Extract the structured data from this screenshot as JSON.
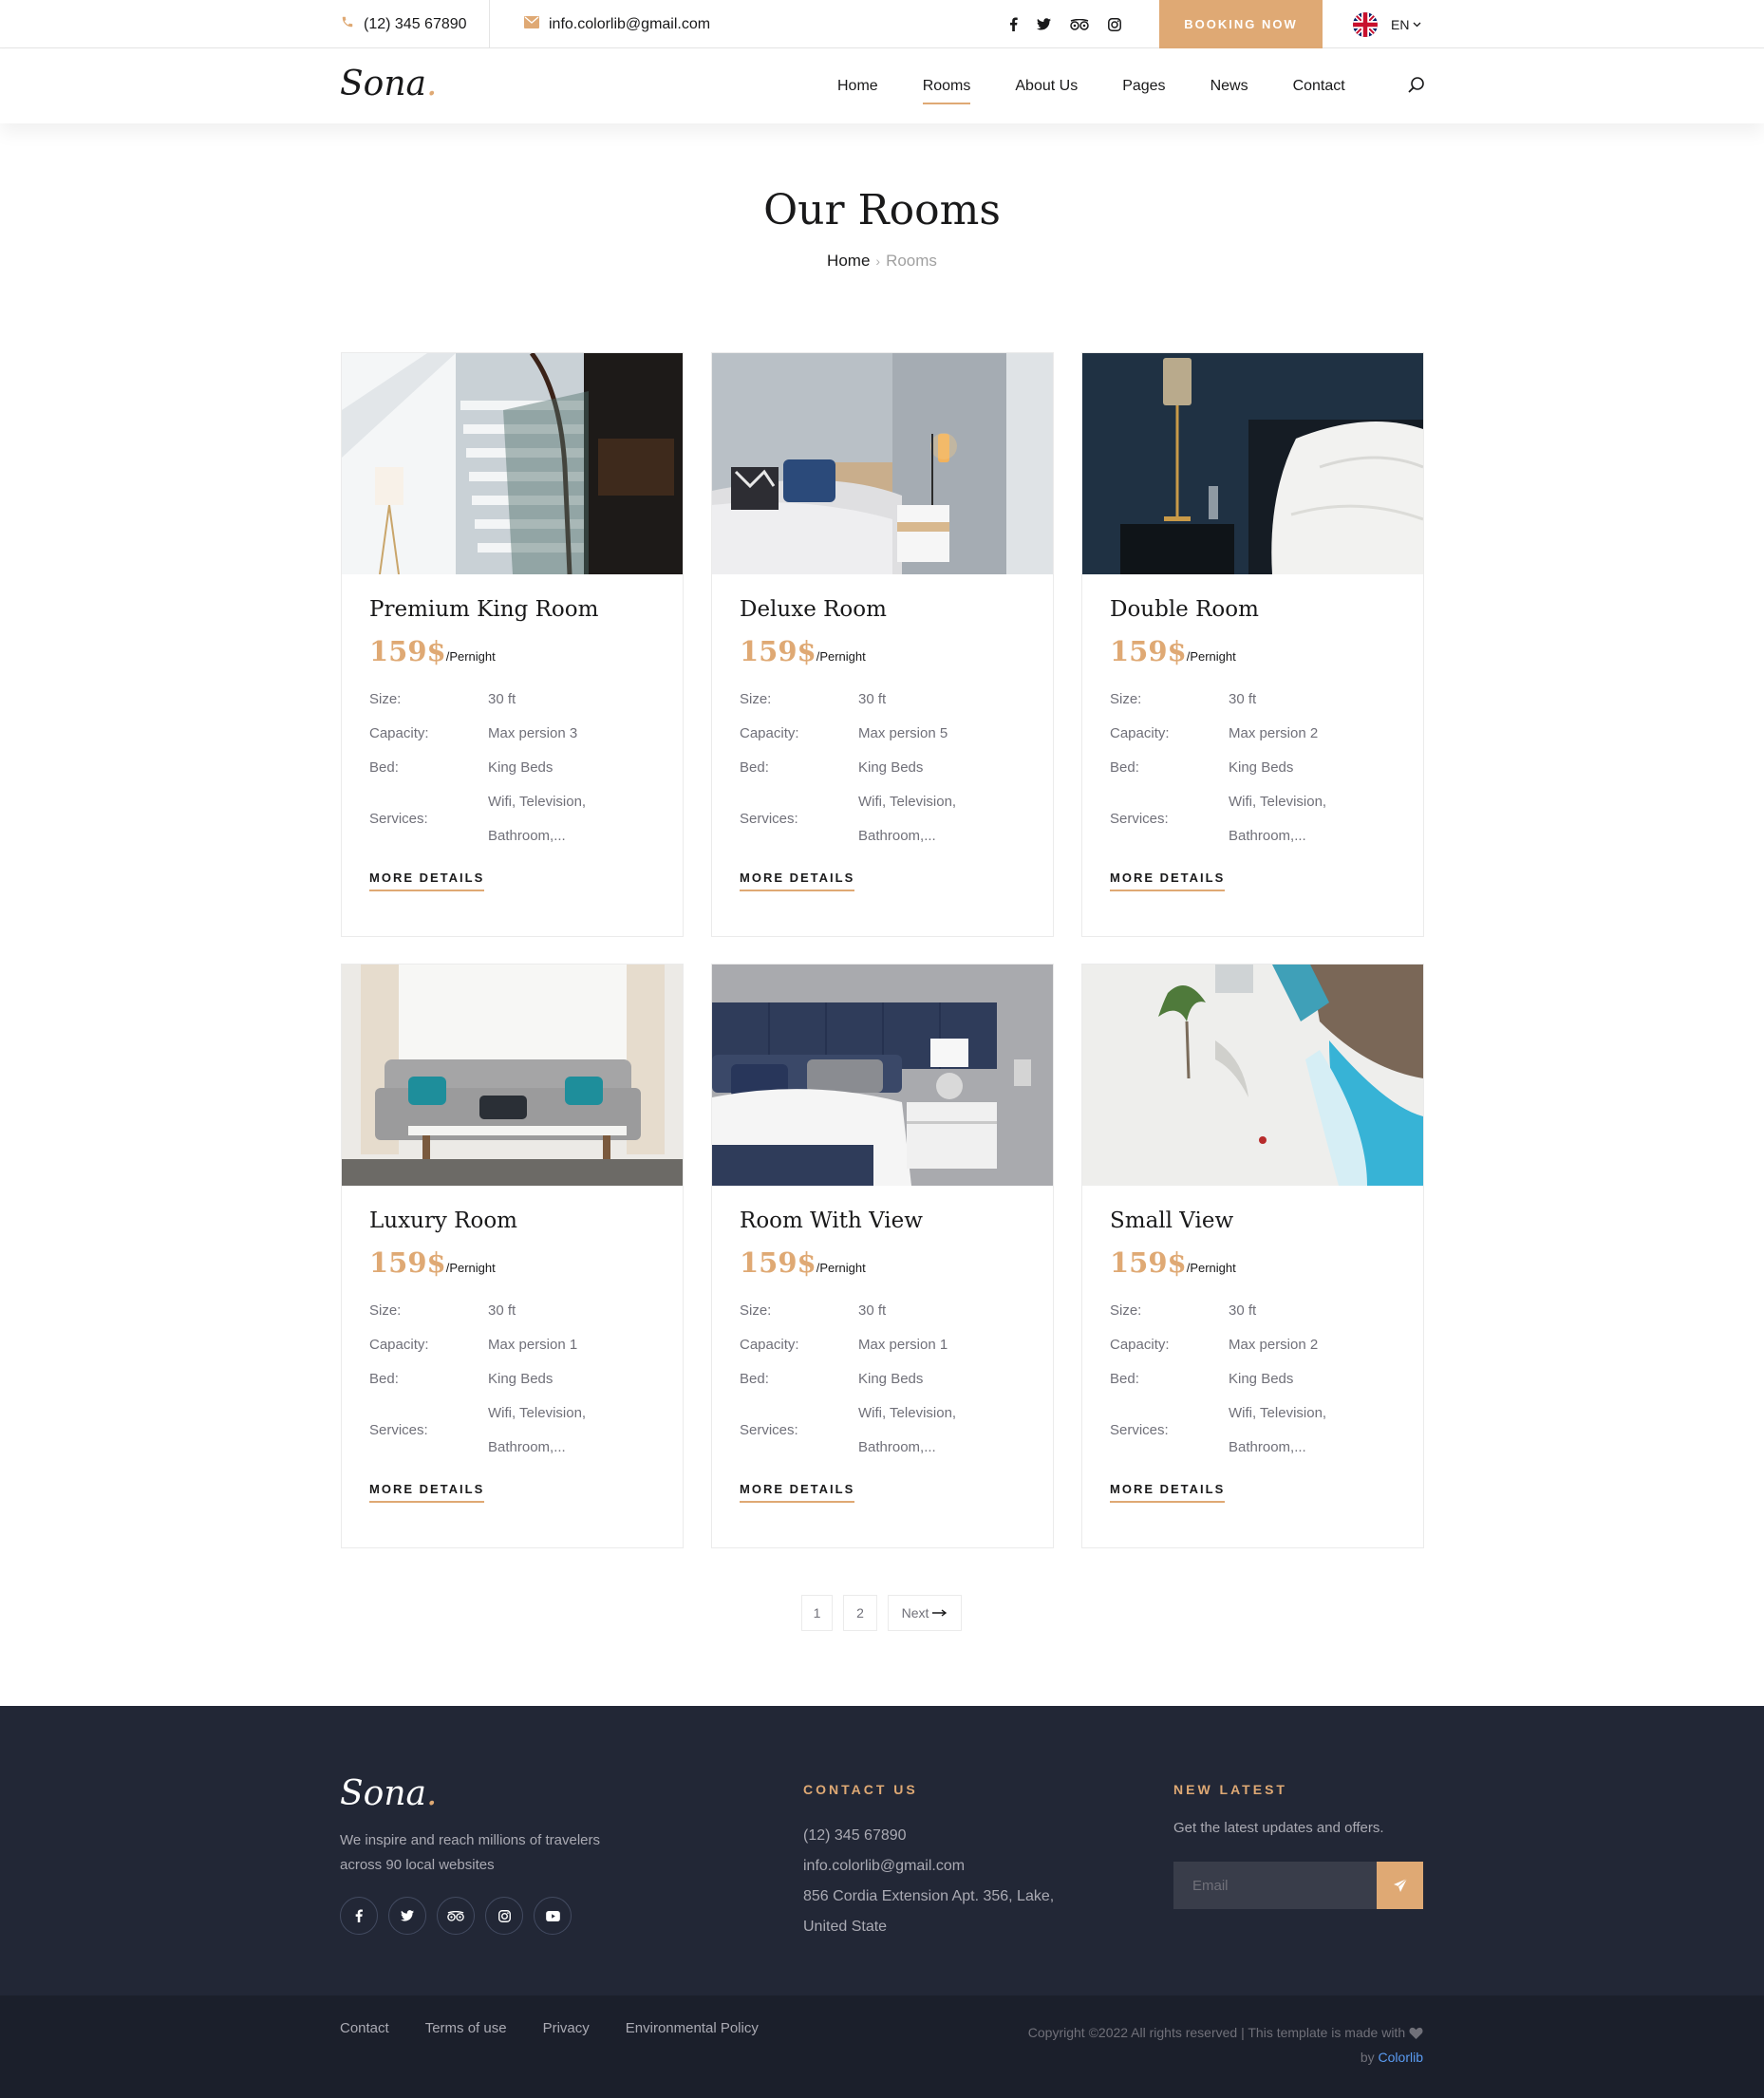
{
  "topbar": {
    "phone": "(12) 345 67890",
    "email": "info.colorlib@gmail.com",
    "socials": [
      "facebook-icon",
      "twitter-icon",
      "tripadvisor-icon",
      "instagram-icon"
    ],
    "booking_label": "BOOKING NOW",
    "language": "EN"
  },
  "nav": {
    "logo": "Sona",
    "logo_dot": ".",
    "items": [
      "Home",
      "Rooms",
      "About Us",
      "Pages",
      "News",
      "Contact"
    ],
    "active": "Rooms"
  },
  "hero": {
    "title": "Our Rooms",
    "breadcrumb_home": "Home",
    "breadcrumb_current": "Rooms"
  },
  "rooms": [
    {
      "name": "Premium King Room",
      "price": "159$",
      "unit": "/Pernight",
      "size_label": "Size:",
      "size": "30 ft",
      "capacity_label": "Capacity:",
      "capacity": "Max persion 3",
      "bed_label": "Bed:",
      "bed": "King Beds",
      "services_label": "Services:",
      "services_1": "Wifi, Television,",
      "services_2": "Bathroom,...",
      "more": "MORE DETAILS"
    },
    {
      "name": "Deluxe Room",
      "price": "159$",
      "unit": "/Pernight",
      "size_label": "Size:",
      "size": "30 ft",
      "capacity_label": "Capacity:",
      "capacity": "Max persion 5",
      "bed_label": "Bed:",
      "bed": "King Beds",
      "services_label": "Services:",
      "services_1": "Wifi, Television,",
      "services_2": "Bathroom,...",
      "more": "MORE DETAILS"
    },
    {
      "name": "Double Room",
      "price": "159$",
      "unit": "/Pernight",
      "size_label": "Size:",
      "size": "30 ft",
      "capacity_label": "Capacity:",
      "capacity": "Max persion 2",
      "bed_label": "Bed:",
      "bed": "King Beds",
      "services_label": "Services:",
      "services_1": "Wifi, Television,",
      "services_2": "Bathroom,...",
      "more": "MORE DETAILS"
    },
    {
      "name": "Luxury Room",
      "price": "159$",
      "unit": "/Pernight",
      "size_label": "Size:",
      "size": "30 ft",
      "capacity_label": "Capacity:",
      "capacity": "Max persion 1",
      "bed_label": "Bed:",
      "bed": "King Beds",
      "services_label": "Services:",
      "services_1": "Wifi, Television,",
      "services_2": "Bathroom,...",
      "more": "MORE DETAILS"
    },
    {
      "name": "Room With View",
      "price": "159$",
      "unit": "/Pernight",
      "size_label": "Size:",
      "size": "30 ft",
      "capacity_label": "Capacity:",
      "capacity": "Max persion 1",
      "bed_label": "Bed:",
      "bed": "King Beds",
      "services_label": "Services:",
      "services_1": "Wifi, Television,",
      "services_2": "Bathroom,...",
      "more": "MORE DETAILS"
    },
    {
      "name": "Small View",
      "price": "159$",
      "unit": "/Pernight",
      "size_label": "Size:",
      "size": "30 ft",
      "capacity_label": "Capacity:",
      "capacity": "Max persion 2",
      "bed_label": "Bed:",
      "bed": "King Beds",
      "services_label": "Services:",
      "services_1": "Wifi, Television,",
      "services_2": "Bathroom,...",
      "more": "MORE DETAILS"
    }
  ],
  "pagination": {
    "pages": [
      "1",
      "2"
    ],
    "next": "Next"
  },
  "footer": {
    "logo": "Sona",
    "logo_dot": ".",
    "about": "We inspire and reach millions of travelers across 90 local websites",
    "socials": [
      "facebook-icon",
      "twitter-icon",
      "tripadvisor-icon",
      "instagram-icon",
      "youtube-icon"
    ],
    "contact_title": "CONTACT US",
    "contact_phone": "(12) 345 67890",
    "contact_email": "info.colorlib@gmail.com",
    "contact_address_1": "856 Cordia Extension Apt. 356, Lake,",
    "contact_address_2": "United State",
    "newsletter_title": "NEW LATEST",
    "newsletter_text": "Get the latest updates and offers.",
    "email_placeholder": "Email",
    "links": [
      "Contact",
      "Terms of use",
      "Privacy",
      "Environmental Policy"
    ],
    "copyright": "Copyright ©2022 All rights reserved | This template is made with",
    "by": "by",
    "brand": "Colorlib"
  },
  "colors": {
    "accent": "#dfa974",
    "footer_bg": "#222736",
    "footer_bottom_bg": "#1b1f2b",
    "text": "#19191a",
    "muted": "#707079"
  }
}
